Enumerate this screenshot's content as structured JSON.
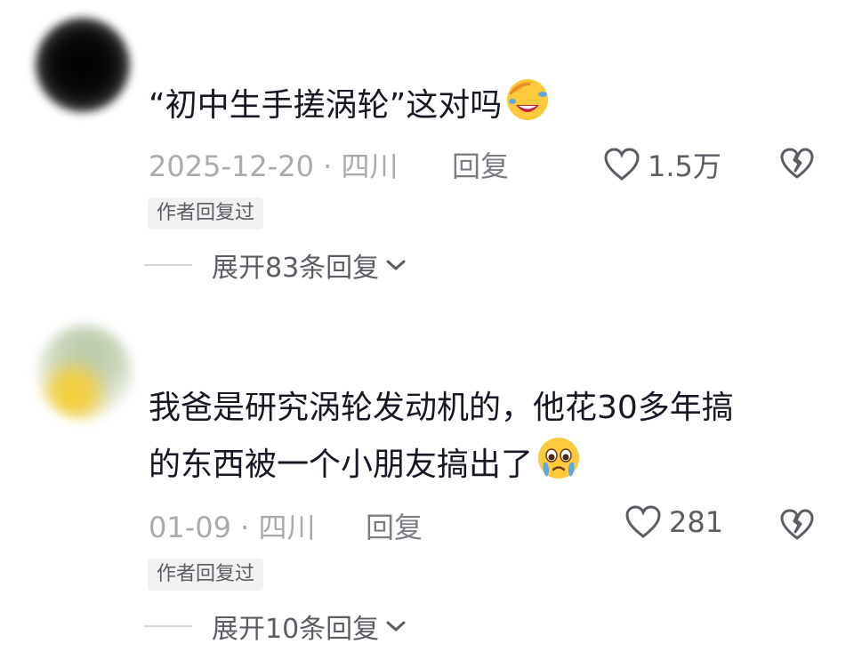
{
  "comments": [
    {
      "text": "“初中生手搓涡轮”这对吗",
      "emoji": "facepalm-laughing-emoji",
      "date": "2025-12-20",
      "separator": "·",
      "location": "四川",
      "reply_label": "回复",
      "like_count": "1.5万",
      "badge": "作者回复过",
      "expand_label": "展开83条回复"
    },
    {
      "text_line1": "我爸是研究涡轮发动机的，他花30多年搞",
      "text_line2": "的东西被一个小朋友搞出了",
      "emoji": "crying-face-emoji",
      "date": "01-09",
      "separator": "·",
      "location": "四川",
      "reply_label": "回复",
      "like_count": "281",
      "badge": "作者回复过",
      "expand_label": "展开10条回复"
    }
  ],
  "colors": {
    "primary_text": "#161823",
    "meta_text": "#a9aab0",
    "secondary_text": "#5c5d64",
    "badge_bg": "#f1f1f2",
    "emoji_yellow": "#ffc93c"
  }
}
